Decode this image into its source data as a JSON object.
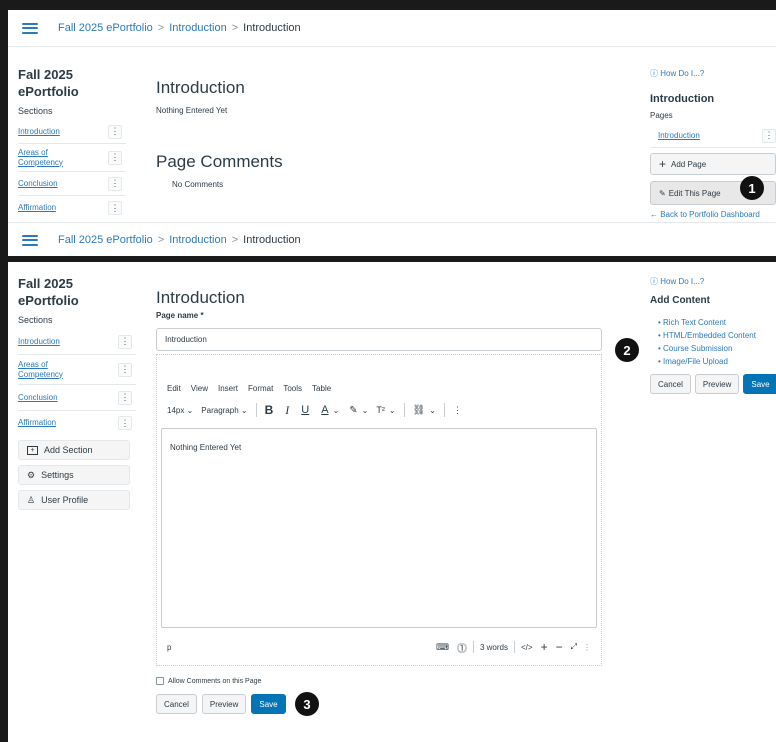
{
  "breadcrumb": {
    "portfolio": "Fall 2025 ePortfolio",
    "section": "Introduction",
    "page": "Introduction",
    "separator": ">"
  },
  "sidebar": {
    "portfolio_title_line1": "Fall 2025",
    "portfolio_title_line2": "ePortfolio",
    "sections_label": "Sections",
    "items": [
      {
        "label": "Introduction"
      },
      {
        "label": "Areas of Competency"
      },
      {
        "label": "Conclusion"
      },
      {
        "label": "Affirmation"
      }
    ],
    "kebab": "⋮",
    "add_section": "Add Section",
    "settings": "Settings",
    "user_profile": "User Profile"
  },
  "view_page": {
    "title": "Introduction",
    "content": "Nothing Entered Yet",
    "comments_title": "Page Comments",
    "comments_empty": "No Comments"
  },
  "view_right": {
    "how_do_i": "How Do I...?",
    "section_title": "Introduction",
    "pages_label": "Pages",
    "page_link": "Introduction",
    "add_page": "Add Page",
    "edit_page": "Edit This Page",
    "back": "← Back to Portfolio Dashboard"
  },
  "edit_page": {
    "title": "Introduction",
    "page_name_label": "Page name *",
    "page_name_value": "Introduction",
    "menu": [
      "Edit",
      "View",
      "Insert",
      "Format",
      "Tools",
      "Table"
    ],
    "font_size": "14px",
    "block": "Paragraph",
    "body_text": "Nothing Entered Yet",
    "status_p": "p",
    "word_count": "3 words",
    "html_toggle": "</>",
    "allow_comments": "Allow Comments on this Page",
    "cancel": "Cancel",
    "preview": "Preview",
    "save": "Save"
  },
  "edit_right": {
    "how_do_i": "How Do I...?",
    "add_content": "Add Content",
    "options": [
      "Rich Text Content",
      "HTML/Embedded Content",
      "Course Submission",
      "Image/File Upload"
    ],
    "cancel": "Cancel",
    "preview": "Preview",
    "save": "Save"
  },
  "callouts": [
    "1",
    "2",
    "3"
  ],
  "colors": {
    "link": "#2b7abc",
    "primary": "#0374b5",
    "text": "#2d3b45",
    "border": "#c7cdd1"
  }
}
